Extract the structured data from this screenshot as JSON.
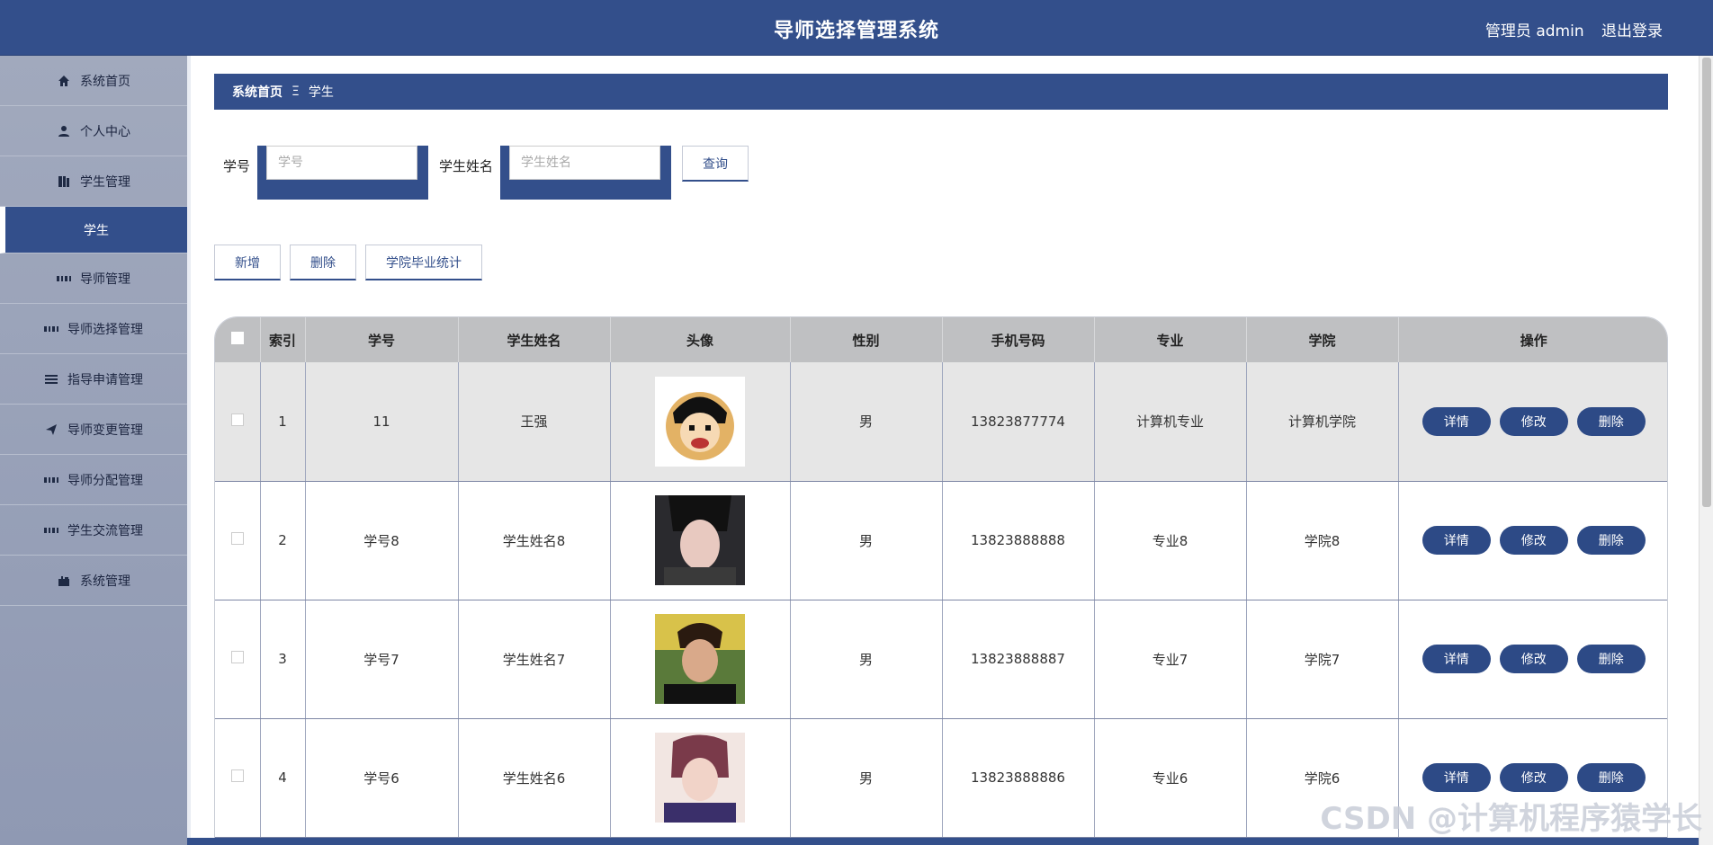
{
  "header": {
    "title": "导师选择管理系统",
    "user_label": "管理员 admin",
    "logout_label": "退出登录"
  },
  "sidebar": {
    "items": [
      {
        "label": "系统首页",
        "icon": "home-icon"
      },
      {
        "label": "个人中心",
        "icon": "user-icon"
      },
      {
        "label": "学生管理",
        "icon": "book-icon"
      },
      {
        "label": "学生",
        "icon": "",
        "active": true
      },
      {
        "label": "导师管理",
        "icon": "grid-icon"
      },
      {
        "label": "导师选择管理",
        "icon": "grid-icon"
      },
      {
        "label": "指导申请管理",
        "icon": "list-icon"
      },
      {
        "label": "导师变更管理",
        "icon": "send-icon"
      },
      {
        "label": "导师分配管理",
        "icon": "grid-icon"
      },
      {
        "label": "学生交流管理",
        "icon": "grid-icon"
      },
      {
        "label": "系统管理",
        "icon": "briefcase-icon"
      }
    ]
  },
  "breadcrumb": {
    "home": "系统首页",
    "separator": "Ξ",
    "current": "学生"
  },
  "search": {
    "student_id_label": "学号",
    "student_id_placeholder": "学号",
    "student_name_label": "学生姓名",
    "student_name_placeholder": "学生姓名",
    "query_label": "查询"
  },
  "actions": {
    "add_label": "新增",
    "delete_label": "删除",
    "stats_label": "学院毕业统计"
  },
  "table": {
    "columns": [
      "索引",
      "学号",
      "学生姓名",
      "头像",
      "性别",
      "手机号码",
      "专业",
      "学院",
      "操作"
    ],
    "rows": [
      {
        "index": "1",
        "student_id": "11",
        "name": "王强",
        "gender": "男",
        "phone": "13823877774",
        "major": "计算机专业",
        "college": "计算机学院"
      },
      {
        "index": "2",
        "student_id": "学号8",
        "name": "学生姓名8",
        "gender": "男",
        "phone": "13823888888",
        "major": "专业8",
        "college": "学院8"
      },
      {
        "index": "3",
        "student_id": "学号7",
        "name": "学生姓名7",
        "gender": "男",
        "phone": "13823888887",
        "major": "专业7",
        "college": "学院7"
      },
      {
        "index": "4",
        "student_id": "学号6",
        "name": "学生姓名6",
        "gender": "男",
        "phone": "13823888886",
        "major": "专业6",
        "college": "学院6"
      }
    ],
    "row_actions": {
      "detail_label": "详情",
      "edit_label": "修改",
      "delete_label": "删除"
    }
  },
  "watermark": "CSDN @计算机程序猿学长",
  "colors": {
    "primary": "#334f8b",
    "header_bg": "#bfc0c2",
    "button": "#2d4a86"
  }
}
